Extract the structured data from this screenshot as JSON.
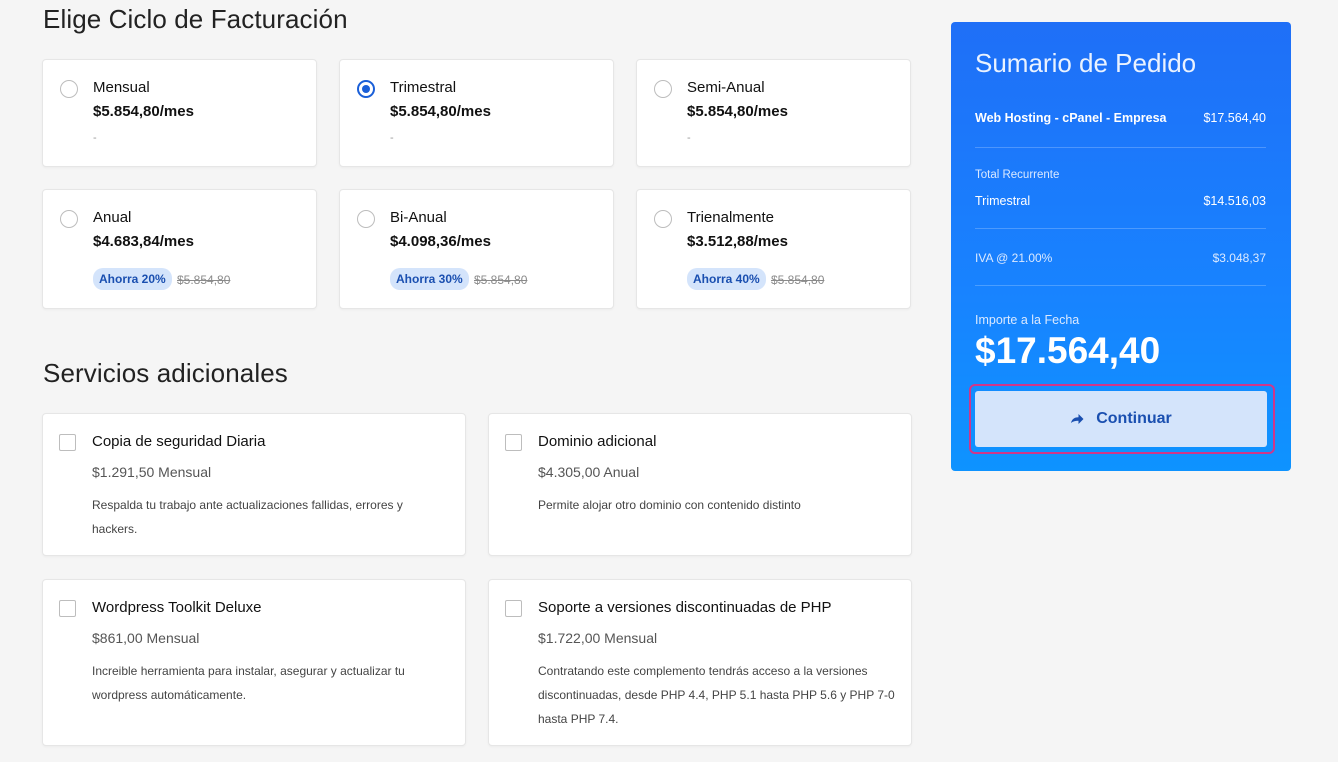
{
  "billing": {
    "title": "Elige Ciclo de Facturación",
    "cycles": [
      {
        "name": "Mensual",
        "price": "$5.854,80/mes",
        "note": "-",
        "selected": false
      },
      {
        "name": "Trimestral",
        "price": "$5.854,80/mes",
        "note": "-",
        "selected": true
      },
      {
        "name": "Semi-Anual",
        "price": "$5.854,80/mes",
        "note": "-",
        "selected": false
      },
      {
        "name": "Anual",
        "price": "$4.683,84/mes",
        "badge": "Ahorra 20%",
        "old_price": "$5.854,80",
        "selected": false
      },
      {
        "name": "Bi-Anual",
        "price": "$4.098,36/mes",
        "badge": "Ahorra 30%",
        "old_price": "$5.854,80",
        "selected": false
      },
      {
        "name": "Trienalmente",
        "price": "$3.512,88/mes",
        "badge": "Ahorra 40%",
        "old_price": "$5.854,80",
        "selected": false
      }
    ]
  },
  "addons": {
    "title": "Servicios adicionales",
    "items": [
      {
        "name": "Copia de seguridad Diaria",
        "price": "$1.291,50 Mensual",
        "desc": "Respalda tu trabajo ante actualizaciones fallidas, errores y hackers.",
        "checked": false
      },
      {
        "name": "Dominio adicional",
        "price": "$4.305,00 Anual",
        "desc": "Permite alojar otro dominio con contenido distinto",
        "checked": false
      },
      {
        "name": "Wordpress Toolkit Deluxe",
        "price": "$861,00 Mensual",
        "desc": "Increible herramienta para instalar, asegurar y actualizar tu wordpress automáticamente.",
        "checked": false
      },
      {
        "name": "Soporte a versiones discontinuadas de PHP",
        "price": "$1.722,00 Mensual",
        "desc": "Contratando este complemento tendrás acceso a la versiones discontinuadas, desde PHP 4.4, PHP 5.1 hasta PHP 5.6 y PHP 7-0 hasta PHP 7.4.",
        "checked": false
      }
    ]
  },
  "summary": {
    "title": "Sumario de Pedido",
    "product_name": "Web Hosting - cPanel - Empresa",
    "product_price": "$17.564,40",
    "recurring_label": "Total Recurrente",
    "recurring_cycle": "Trimestral",
    "recurring_amount": "$14.516,03",
    "tax_label": "IVA @ 21.00%",
    "tax_amount": "$3.048,37",
    "due_label": "Importe a la Fecha",
    "due_amount": "$17.564,40",
    "continue_label": "Continuar"
  },
  "colors": {
    "accent": "#1a5fd8",
    "summary_bg": "#1883ff",
    "badge_bg": "#d4e4fb",
    "focus_outline": "#d0368a"
  },
  "icons": {
    "continue": "arrow-right-icon"
  }
}
